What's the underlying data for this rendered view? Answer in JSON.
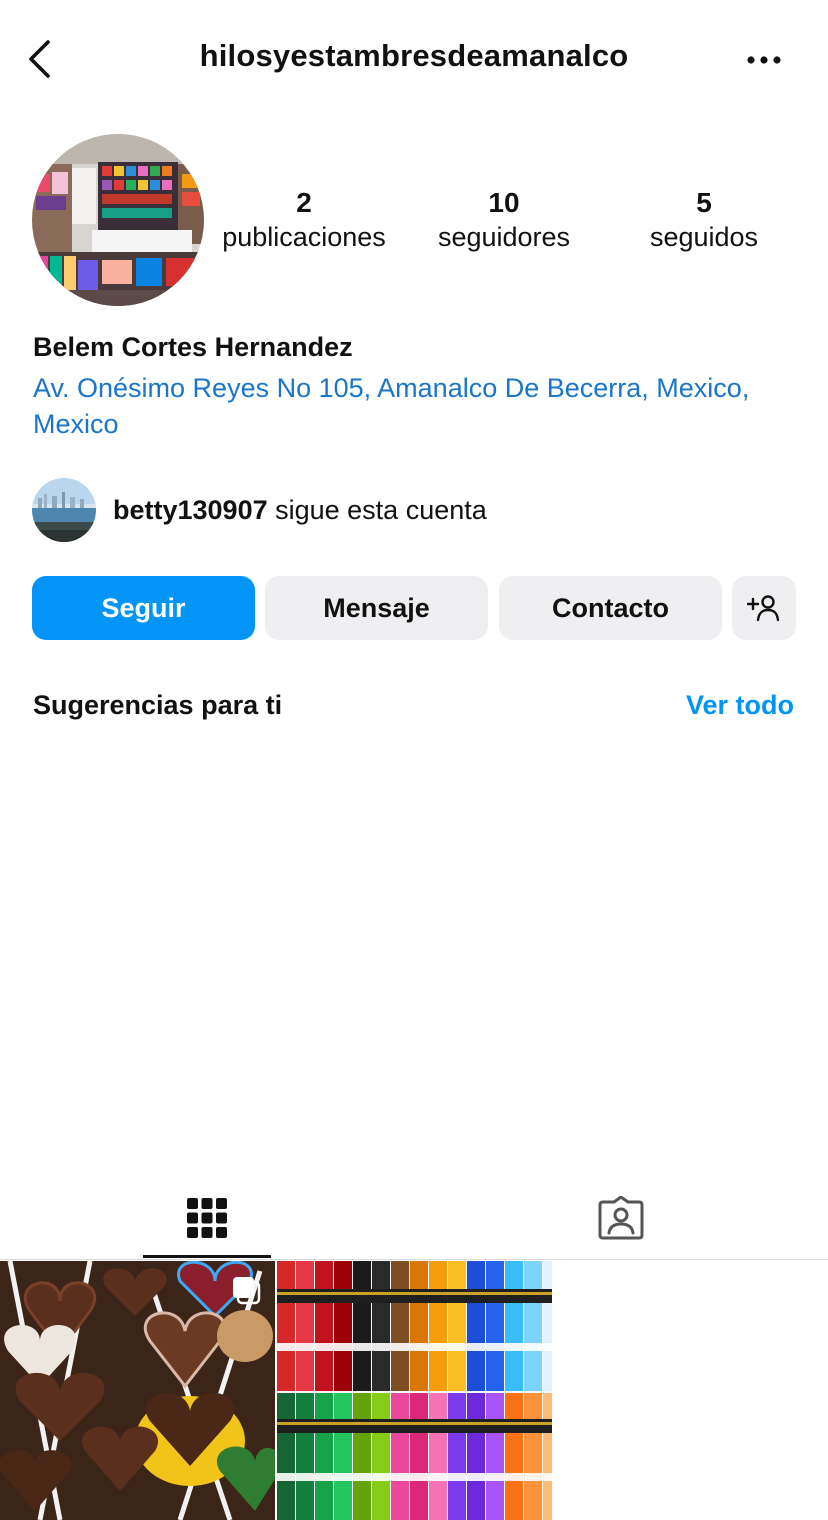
{
  "header": {
    "username": "hilosyestambresdeamanalco"
  },
  "profile": {
    "stats": [
      {
        "value": "2",
        "label": "publicaciones"
      },
      {
        "value": "10",
        "label": "seguidores"
      },
      {
        "value": "5",
        "label": "seguidos"
      }
    ],
    "name": "Belem Cortes Hernandez",
    "address": "Av. Onésimo Reyes No 105, Amanalco De Becerra, Mexico, Mexico"
  },
  "followed_by": {
    "username": "betty130907",
    "suffix": " sigue esta cuenta"
  },
  "actions": {
    "follow": "Seguir",
    "message": "Mensaje",
    "contact": "Contacto"
  },
  "suggestions": {
    "title": "Sugerencias para ti",
    "see_all": "Ver todo"
  },
  "tabs": [
    {
      "icon": "grid-icon",
      "active": true
    },
    {
      "icon": "tagged-icon",
      "active": false
    }
  ],
  "posts": [
    {
      "description_icon": "chocolate-lollipops-photo",
      "multiple": true
    },
    {
      "description_icon": "embroidery-thread-skeins-photo",
      "multiple": false
    }
  ],
  "colors": {
    "primary_blue": "#0095f6",
    "link_blue": "#1a76c9",
    "button_gray": "#efeff1"
  }
}
